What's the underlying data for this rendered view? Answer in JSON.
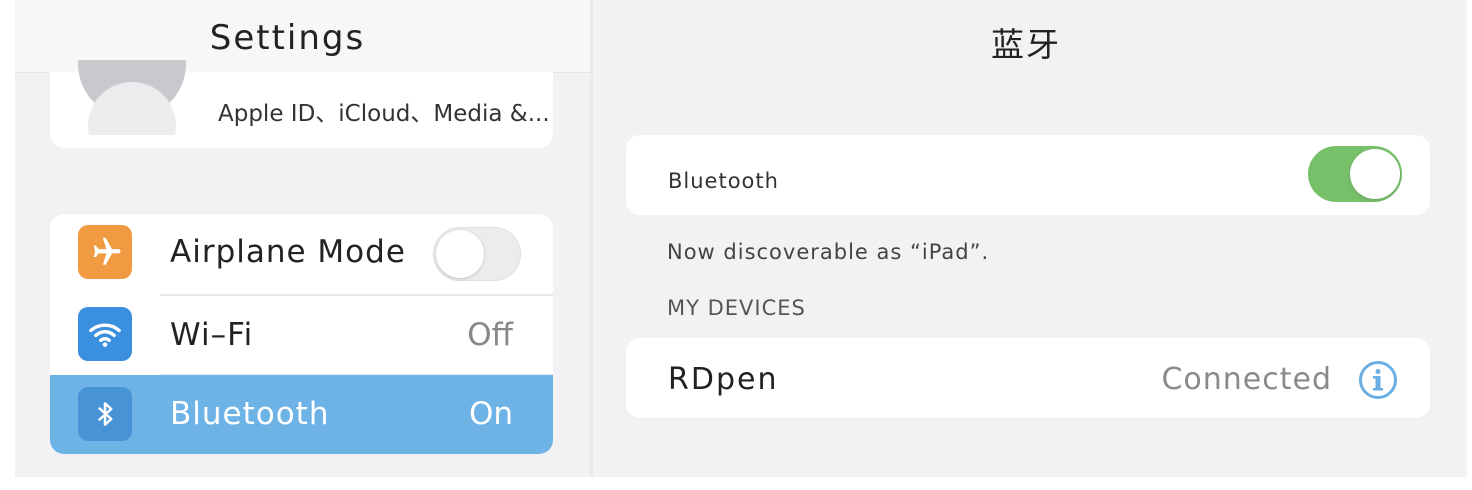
{
  "left_pane": {
    "title": "Settings",
    "profile": {
      "subtitle": "Apple ID、iCloud、Media &..."
    },
    "rows": [
      {
        "label": "Airplane  Mode",
        "icon": "airplane-icon",
        "toggle_on": false
      },
      {
        "label": "Wi–Fi",
        "value": "Off",
        "icon": "wifi-icon"
      },
      {
        "label": "Bluetooth",
        "value": "On",
        "icon": "bluetooth-icon",
        "selected": true
      }
    ]
  },
  "right_pane": {
    "title": "蓝牙",
    "bluetooth_label": "Bluetooth",
    "bluetooth_on": true,
    "discoverable_text": "Now discoverable as “iPad”.",
    "section_header": "MY DEVICES",
    "devices": [
      {
        "name": "RDpen",
        "status": "Connected"
      }
    ]
  },
  "colors": {
    "selected_row": "#6db3e5",
    "toggle_on": "#77c06a",
    "airplane_icon_bg": "#f09a42",
    "wifi_icon_bg": "#3a8fde",
    "info_icon": "#6aaee3"
  }
}
